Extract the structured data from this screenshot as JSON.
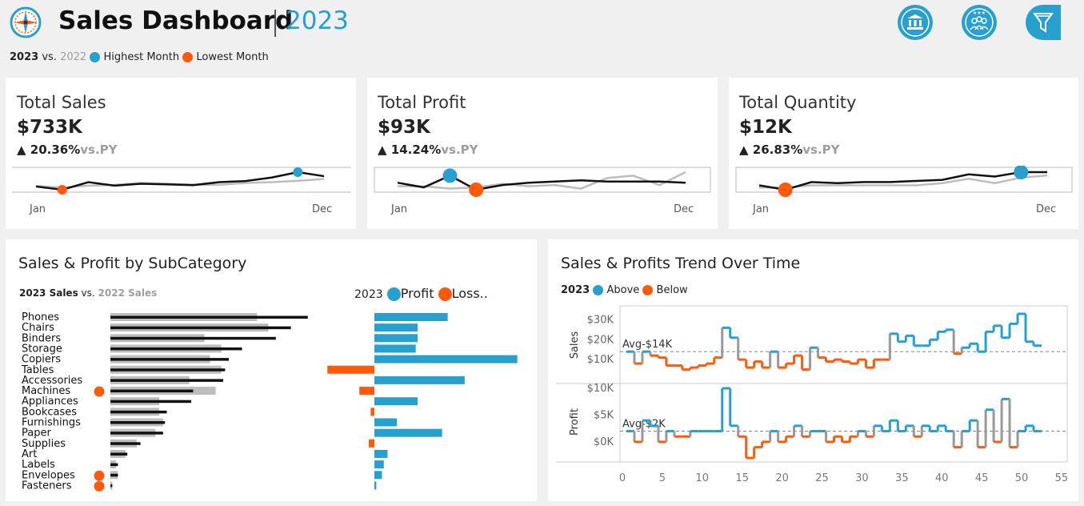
{
  "header": {
    "title": "Sales Dashboard",
    "year": "2023",
    "icons": [
      "bank-icon",
      "team-icon",
      "filter-icon"
    ],
    "legend": {
      "current": "2023",
      "vs": "vs.",
      "prior": "2022",
      "highest": "Highest Month",
      "lowest": "Lowest Month"
    }
  },
  "colors": {
    "accent": "#27a0cf",
    "loss": "#fe5a0a",
    "current": "#111111",
    "prior": "#bdbdbd"
  },
  "kpis": [
    {
      "label": "Total Sales",
      "value": "$733K",
      "change": "▲ 20.36%",
      "vs": "vs.PY",
      "start": "Jan",
      "end": "Dec"
    },
    {
      "label": "Total Profit",
      "value": "$93K",
      "change": "▲ 14.24%",
      "vs": "vs.PY",
      "start": "Jan",
      "end": "Dec"
    },
    {
      "label": "Total Quantity",
      "value": "$12K",
      "change": "▲ 26.83%",
      "vs": "vs.PY",
      "start": "Jan",
      "end": "Dec"
    }
  ],
  "subcategory": {
    "title": "Sales & Profit by SubCategory",
    "legend_sales": {
      "current": "2023 Sales",
      "vs": "vs.",
      "prior": "2022 Sales"
    },
    "legend_profit": {
      "year": "2023",
      "profit": "Profit",
      "loss": "Loss.."
    },
    "rows": [
      {
        "name": "Phones",
        "sales2023": 105,
        "sales2022": 78,
        "profit": 39,
        "low_flag": false
      },
      {
        "name": "Chairs",
        "sales2023": 96,
        "sales2022": 84,
        "profit": 23,
        "low_flag": false
      },
      {
        "name": "Binders",
        "sales2023": 88,
        "sales2022": 50,
        "profit": 23,
        "low_flag": false
      },
      {
        "name": "Storage",
        "sales2023": 70,
        "sales2022": 59,
        "profit": 22,
        "low_flag": false
      },
      {
        "name": "Copiers",
        "sales2023": 63,
        "sales2022": 53,
        "profit": 76,
        "low_flag": false
      },
      {
        "name": "Tables",
        "sales2023": 61,
        "sales2022": 59,
        "profit": -25,
        "low_flag": false
      },
      {
        "name": "Accessories",
        "sales2023": 60,
        "sales2022": 42,
        "profit": 48,
        "low_flag": false
      },
      {
        "name": "Machines",
        "sales2023": 44,
        "sales2022": 56,
        "profit": -8,
        "low_flag": true
      },
      {
        "name": "Appliances",
        "sales2023": 43,
        "sales2022": 26,
        "profit": 23,
        "low_flag": false
      },
      {
        "name": "Bookcases",
        "sales2023": 30,
        "sales2022": 26,
        "profit": -2,
        "low_flag": false
      },
      {
        "name": "Furnishings",
        "sales2023": 29,
        "sales2022": 28,
        "profit": 12,
        "low_flag": false
      },
      {
        "name": "Paper",
        "sales2023": 28,
        "sales2022": 24,
        "profit": 36,
        "low_flag": false
      },
      {
        "name": "Supplies",
        "sales2023": 16,
        "sales2022": 14,
        "profit": -3,
        "low_flag": false
      },
      {
        "name": "Art",
        "sales2023": 9,
        "sales2022": 8,
        "profit": 7,
        "low_flag": false
      },
      {
        "name": "Labels",
        "sales2023": 4,
        "sales2022": 3,
        "profit": 5,
        "low_flag": false
      },
      {
        "name": "Envelopes",
        "sales2023": 4,
        "sales2022": 4,
        "profit": 4,
        "low_flag": true
      },
      {
        "name": "Fasteners",
        "sales2023": 1,
        "sales2022": 1,
        "profit": 1,
        "low_flag": true
      }
    ]
  },
  "trend": {
    "title": "Sales & Profits Trend Over Time",
    "legend": {
      "year": "2023",
      "above": "Above",
      "below": "Below"
    },
    "sales_label": "Sales",
    "profit_label": "Profit",
    "sales_avg_label": "Avg-$14K",
    "profit_avg_label": "Avg-$2K",
    "sales_ticks": [
      "$30K",
      "$20K",
      "$10K"
    ],
    "profit_ticks": [
      "$10K",
      "$5K",
      "$0K"
    ],
    "x_ticks": [
      "0",
      "5",
      "10",
      "15",
      "20",
      "25",
      "30",
      "35",
      "40",
      "45",
      "50",
      "55"
    ]
  },
  "chart_data": [
    {
      "type": "line",
      "title": "Total Sales",
      "x": [
        "Jan",
        "Feb",
        "Mar",
        "Apr",
        "May",
        "Jun",
        "Jul",
        "Aug",
        "Sep",
        "Oct",
        "Nov",
        "Dec"
      ],
      "series": [
        {
          "name": "2023",
          "values": [
            42,
            30,
            58,
            45,
            52,
            50,
            47,
            58,
            62,
            75,
            95,
            80
          ]
        },
        {
          "name": "2022",
          "values": [
            44,
            38,
            45,
            48,
            55,
            52,
            49,
            48,
            55,
            58,
            63,
            70
          ]
        }
      ],
      "highest": "Nov",
      "lowest": "Feb"
    },
    {
      "type": "line",
      "title": "Total Profit",
      "x": [
        "Jan",
        "Feb",
        "Mar",
        "Apr",
        "May",
        "Jun",
        "Jul",
        "Aug",
        "Sep",
        "Oct",
        "Nov",
        "Dec"
      ],
      "series": [
        {
          "name": "2023",
          "values": [
            8,
            4,
            14,
            2,
            6,
            8,
            9,
            10,
            9,
            9,
            9,
            8
          ]
        },
        {
          "name": "2022",
          "values": [
            5,
            5,
            3,
            4,
            7,
            5,
            6,
            3,
            12,
            14,
            6,
            17
          ]
        }
      ],
      "highest": "Mar",
      "lowest": "Apr"
    },
    {
      "type": "line",
      "title": "Total Quantity",
      "x": [
        "Jan",
        "Feb",
        "Mar",
        "Apr",
        "May",
        "Jun",
        "Jul",
        "Aug",
        "Sep",
        "Oct",
        "Nov",
        "Dec"
      ],
      "series": [
        {
          "name": "2023",
          "values": [
            0.8,
            0.6,
            0.95,
            0.9,
            0.95,
            0.95,
            1.0,
            1.05,
            1.3,
            1.2,
            1.4,
            1.4
          ]
        },
        {
          "name": "2022",
          "values": [
            0.7,
            0.7,
            0.8,
            0.8,
            0.8,
            0.8,
            0.8,
            0.9,
            1.1,
            0.9,
            1.15,
            1.25
          ]
        }
      ],
      "highest": "Nov",
      "lowest": "Feb"
    },
    {
      "type": "bar",
      "title": "Sales & Profit by SubCategory",
      "categories": [
        "Phones",
        "Chairs",
        "Binders",
        "Storage",
        "Copiers",
        "Tables",
        "Accessories",
        "Machines",
        "Appliances",
        "Bookcases",
        "Furnishings",
        "Paper",
        "Supplies",
        "Art",
        "Labels",
        "Envelopes",
        "Fasteners"
      ],
      "series": [
        {
          "name": "2023 Sales",
          "values": [
            105,
            96,
            88,
            70,
            63,
            61,
            60,
            44,
            43,
            30,
            29,
            28,
            16,
            9,
            4,
            4,
            1
          ]
        },
        {
          "name": "2022 Sales",
          "values": [
            78,
            84,
            50,
            59,
            53,
            59,
            42,
            56,
            26,
            26,
            28,
            24,
            14,
            8,
            3,
            4,
            1
          ]
        },
        {
          "name": "Profit",
          "values": [
            39,
            23,
            23,
            22,
            76,
            -25,
            48,
            -8,
            23,
            -2,
            12,
            36,
            -3,
            7,
            5,
            4,
            1
          ]
        }
      ]
    },
    {
      "type": "line",
      "title": "Sales & Profits Trend Over Time",
      "xlabel": "",
      "x": [
        1,
        2,
        3,
        4,
        5,
        6,
        7,
        8,
        9,
        10,
        11,
        12,
        13,
        14,
        15,
        16,
        17,
        18,
        19,
        20,
        21,
        22,
        23,
        24,
        25,
        26,
        27,
        28,
        29,
        30,
        31,
        32,
        33,
        34,
        35,
        36,
        37,
        38,
        39,
        40,
        41,
        42,
        43,
        44,
        45,
        46,
        47,
        48,
        49,
        50,
        51,
        52
      ],
      "xlim": [
        0,
        55
      ],
      "series": [
        {
          "name": "Sales",
          "ylim": [
            0,
            35
          ],
          "avg": 14,
          "values": [
            14,
            8,
            14,
            12,
            11,
            7,
            7,
            5,
            6,
            7,
            8,
            11,
            26,
            21,
            10,
            6,
            9,
            6,
            14,
            6,
            8,
            12,
            5,
            16,
            11,
            9,
            10,
            9,
            8,
            10,
            6,
            10,
            10,
            23,
            19,
            22,
            17,
            17,
            20,
            24,
            25,
            13,
            16,
            18,
            14,
            24,
            27,
            21,
            28,
            33,
            19,
            17
          ]
        },
        {
          "name": "Profit",
          "ylim": [
            -3,
            10
          ],
          "avg": 2,
          "values": [
            2,
            0,
            4,
            3,
            0,
            2,
            1,
            1,
            2,
            2,
            2,
            2,
            10,
            3,
            1,
            -3,
            -1,
            0,
            2,
            0,
            1,
            3,
            1,
            2,
            2,
            0,
            1,
            0,
            1,
            2,
            1,
            3,
            2,
            4,
            2,
            3,
            1,
            3,
            2,
            3,
            2,
            -1,
            2,
            4,
            -1,
            6,
            0,
            8,
            -1,
            2,
            3,
            2
          ]
        }
      ]
    }
  ]
}
